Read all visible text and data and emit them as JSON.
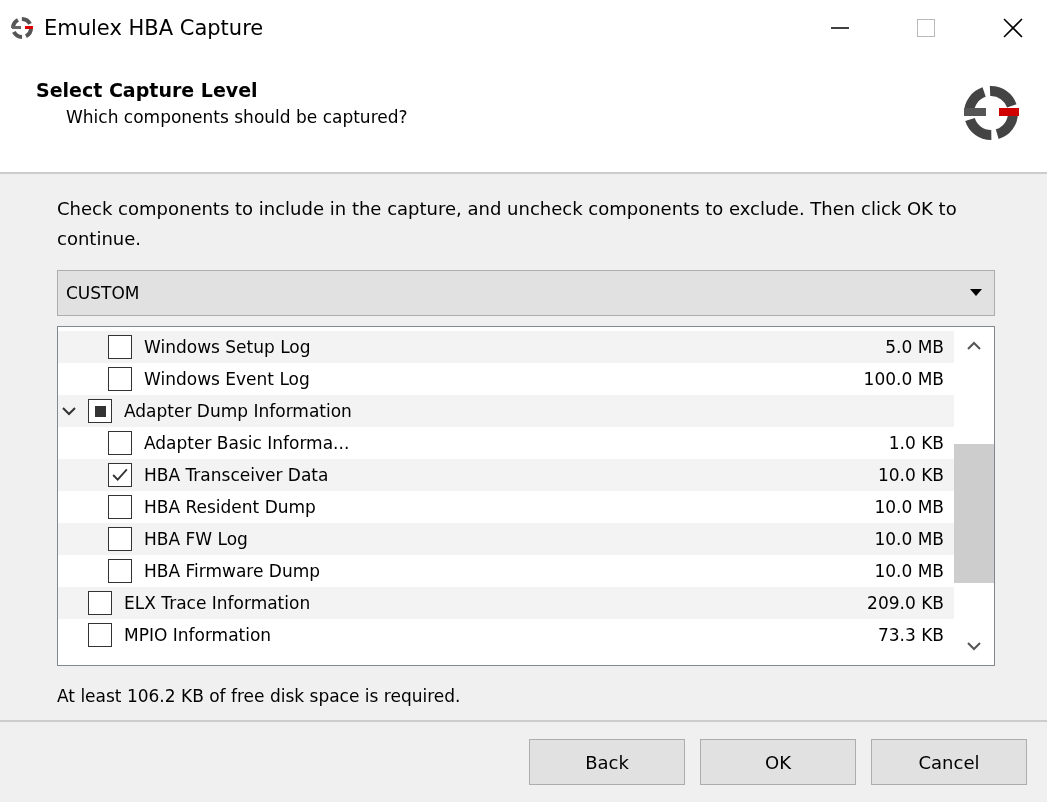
{
  "window": {
    "title": "Emulex HBA Capture"
  },
  "header": {
    "title": "Select Capture Level",
    "subtitle": "Which components should be captured?"
  },
  "instructions": "Check components to include in the capture, and uncheck components to exclude. Then click OK to continue.",
  "level_dropdown": {
    "value": "CUSTOM"
  },
  "components": {
    "continued_children": [
      {
        "label": "Windows Setup Log",
        "size": "5.0 MB",
        "checked": false
      },
      {
        "label": "Windows Event Log",
        "size": "100.0 MB",
        "checked": false
      }
    ],
    "items": [
      {
        "label": "Adapter Dump Information",
        "checked": true,
        "partial": true,
        "expanded": true,
        "children": [
          {
            "label": "Adapter Basic Informa...",
            "size": "1.0 KB",
            "checked": false
          },
          {
            "label": "HBA Transceiver Data",
            "size": "10.0 KB",
            "checked": true
          },
          {
            "label": "HBA Resident Dump",
            "size": "10.0 MB",
            "checked": false
          },
          {
            "label": "HBA FW Log",
            "size": "10.0 MB",
            "checked": false
          },
          {
            "label": "HBA Firmware Dump",
            "size": "10.0 MB",
            "checked": false
          }
        ]
      },
      {
        "label": "ELX Trace Information",
        "size": "209.0 KB",
        "checked": false
      },
      {
        "label": "MPIO Information",
        "size": "73.3 KB",
        "checked": false
      }
    ]
  },
  "space_note": "At least 106.2 KB of free disk space is required.",
  "buttons": [
    {
      "label": "Back"
    },
    {
      "label": "OK"
    },
    {
      "label": "Cancel"
    }
  ]
}
